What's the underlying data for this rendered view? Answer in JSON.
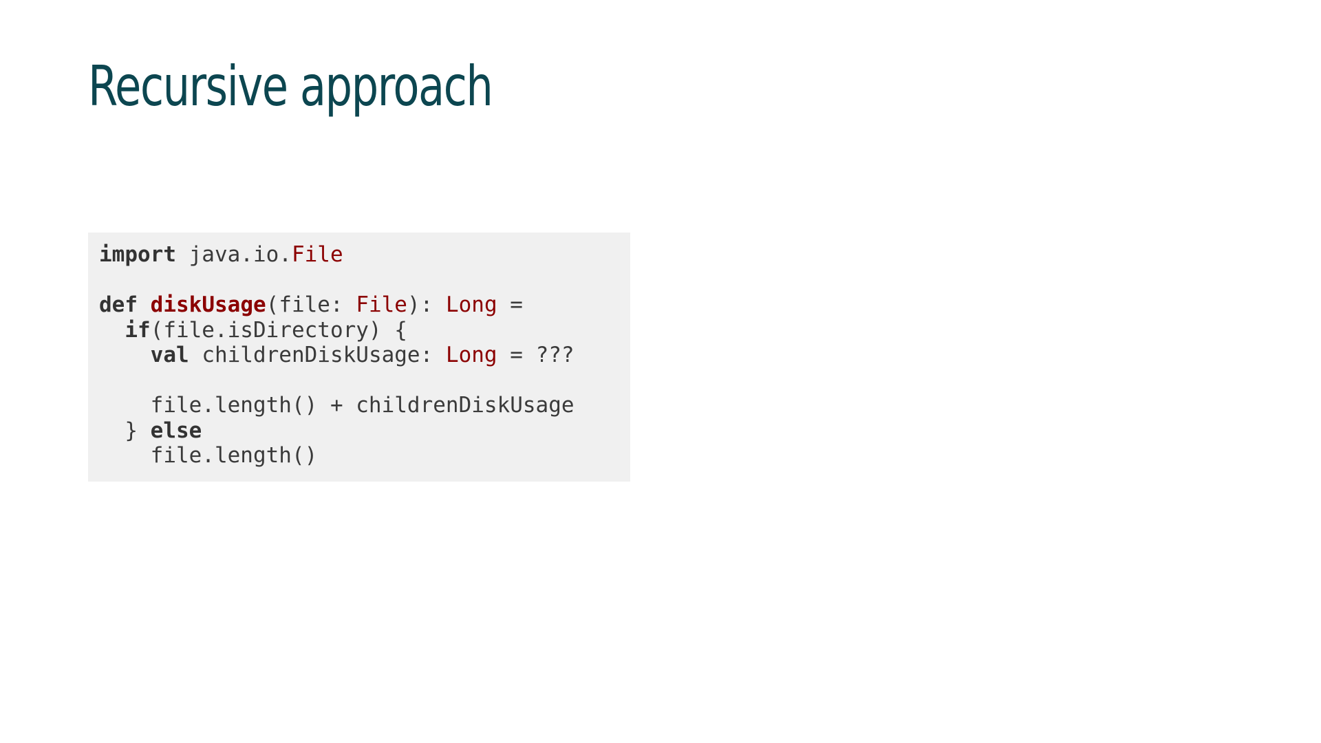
{
  "slide": {
    "title": "Recursive approach"
  },
  "code_block": {
    "language": "scala",
    "lines": [
      [
        {
          "text": "import",
          "kind": "kw"
        },
        {
          "text": " java.io.",
          "kind": "tx"
        },
        {
          "text": "File",
          "kind": "ty"
        }
      ],
      [],
      [
        {
          "text": "def",
          "kind": "kw"
        },
        {
          "text": " ",
          "kind": "tx"
        },
        {
          "text": "diskUsage",
          "kind": "fn"
        },
        {
          "text": "(file: ",
          "kind": "tx"
        },
        {
          "text": "File",
          "kind": "ty"
        },
        {
          "text": "): ",
          "kind": "tx"
        },
        {
          "text": "Long",
          "kind": "ty"
        },
        {
          "text": " =",
          "kind": "tx"
        }
      ],
      [
        {
          "text": "  ",
          "kind": "tx"
        },
        {
          "text": "if",
          "kind": "kw"
        },
        {
          "text": "(file.isDirectory) {",
          "kind": "tx"
        }
      ],
      [
        {
          "text": "    ",
          "kind": "tx"
        },
        {
          "text": "val",
          "kind": "kw"
        },
        {
          "text": " childrenDiskUsage: ",
          "kind": "tx"
        },
        {
          "text": "Long",
          "kind": "ty"
        },
        {
          "text": " = ???",
          "kind": "tx"
        }
      ],
      [],
      [
        {
          "text": "    file.length() + childrenDiskUsage",
          "kind": "tx"
        }
      ],
      [
        {
          "text": "  } ",
          "kind": "tx"
        },
        {
          "text": "else",
          "kind": "kw"
        }
      ],
      [
        {
          "text": "    file.length()",
          "kind": "tx"
        }
      ]
    ]
  },
  "colors": {
    "title": "#0c4650",
    "code_background": "#f0f0f0",
    "code_text": "#3a3a3a",
    "code_keyword": "#333333",
    "code_type": "#8b0000"
  }
}
